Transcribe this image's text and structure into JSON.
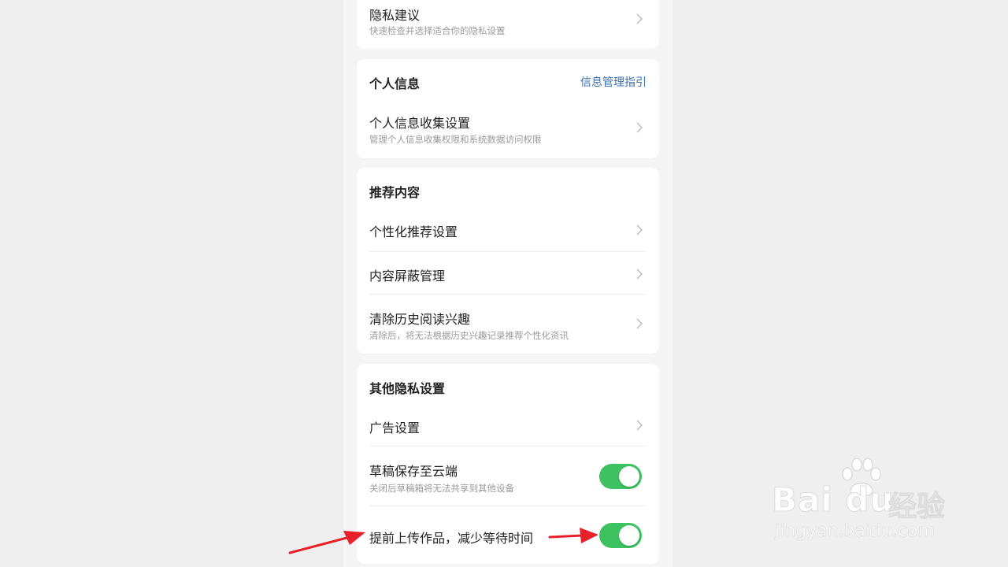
{
  "privacy_suggestion": {
    "title": "隐私建议",
    "subtitle": "快速检查并选择适合你的隐私设置"
  },
  "personal_info": {
    "header": "个人信息",
    "link": "信息管理指引",
    "items": [
      {
        "title": "个人信息收集设置",
        "subtitle": "管理个人信息收集权限和系统数据访问权限"
      }
    ]
  },
  "recommend": {
    "header": "推荐内容",
    "items": [
      {
        "title": "个性化推荐设置"
      },
      {
        "title": "内容屏蔽管理"
      },
      {
        "title": "清除历史阅读兴趣",
        "subtitle": "清除后，将无法根据历史兴趣记录推荐个性化资讯"
      }
    ]
  },
  "other": {
    "header": "其他隐私设置",
    "items": [
      {
        "title": "广告设置"
      },
      {
        "title": "草稿保存至云端",
        "subtitle": "关闭后草稿箱将无法共享到其他设备",
        "toggle_on": true
      },
      {
        "title": "提前上传作品，减少等待时间",
        "toggle_on": true
      }
    ]
  },
  "watermark": {
    "logo": "Bai du",
    "cn": "经验",
    "url": "jingyan.baidu.com"
  },
  "colors": {
    "toggle_on": "#3cc25e",
    "link": "#3a6fb0",
    "arrow": "#e8202a"
  },
  "icons": [
    "chevron-right-icon",
    "toggle-switch",
    "red-arrow-annotation",
    "baidu-paw-logo"
  ]
}
